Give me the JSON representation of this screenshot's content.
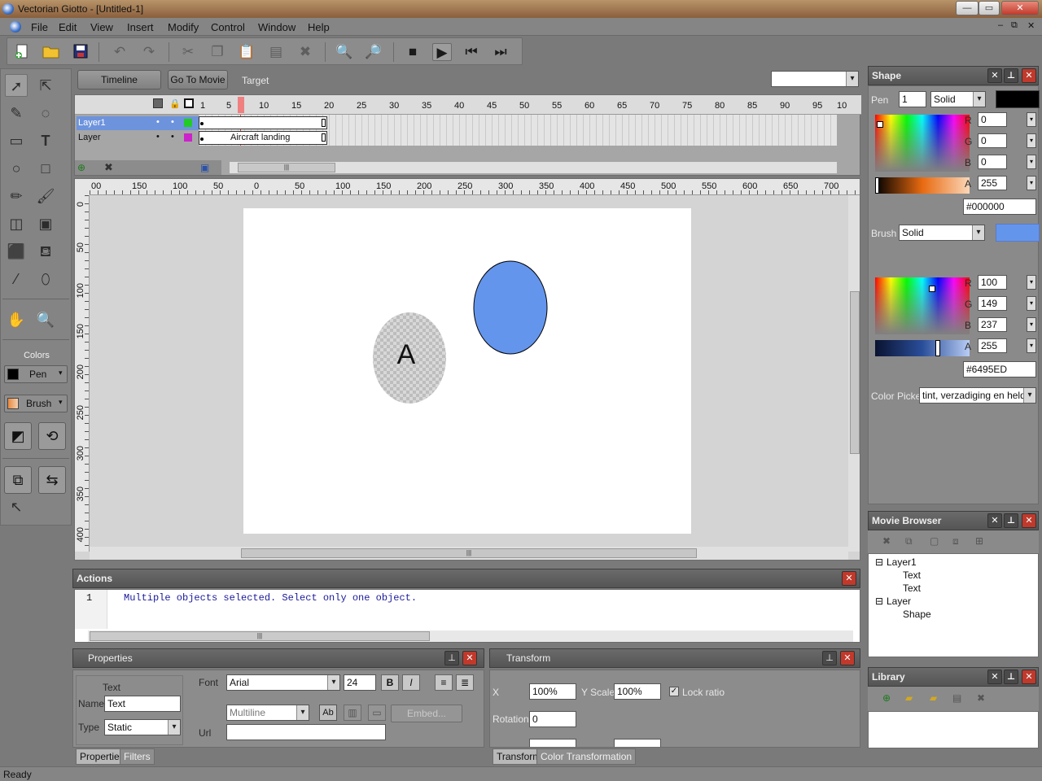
{
  "window": {
    "title": "Vectorian Giotto - [Untitled-1]",
    "min": "—",
    "max": "▭",
    "close": "✕"
  },
  "menu": {
    "items": [
      "File",
      "Edit",
      "View",
      "Insert",
      "Modify",
      "Control",
      "Window",
      "Help"
    ],
    "mdi": [
      "–",
      "⧉",
      "✕"
    ]
  },
  "toolbar": {
    "icons": [
      "new-icon",
      "open-icon",
      "save-icon",
      "undo-icon",
      "redo-icon",
      "cut-icon",
      "copy-icon",
      "paste-icon",
      "paste-special-icon",
      "delete-icon",
      "zoom-in-icon",
      "zoom-out-icon",
      "stop-icon",
      "play-icon",
      "first-frame-icon",
      "last-frame-icon"
    ]
  },
  "header": {
    "timeline_btn": "Timeline",
    "goto_btn": "Go To Movie",
    "target_label": "Target",
    "target_value": ""
  },
  "timeline": {
    "ruler": [
      "1",
      "5",
      "10",
      "15",
      "20",
      "25",
      "30",
      "35",
      "40",
      "45",
      "50",
      "55",
      "60",
      "65",
      "70",
      "75",
      "80",
      "85",
      "90",
      "95",
      "10"
    ],
    "layers": [
      {
        "name": "Layer1",
        "color": "#22cc22",
        "selected": true,
        "frame_label": ""
      },
      {
        "name": "Layer",
        "color": "#cc22cc",
        "selected": false,
        "frame_label": "Aircraft landing"
      }
    ],
    "scroll_mark": "|||"
  },
  "stage": {
    "hruler": [
      "00",
      "150",
      "100",
      "50",
      "0",
      "50",
      "100",
      "150",
      "200",
      "250",
      "300",
      "350",
      "400",
      "450",
      "500",
      "550",
      "600",
      "650",
      "700",
      "7"
    ],
    "vruler": [
      "0",
      "50",
      "100",
      "150",
      "200",
      "250",
      "300",
      "350",
      "400"
    ],
    "text_in_shape": "A",
    "ellipse_fill": "#6495ED",
    "scroll_mark": "|||"
  },
  "colors_panel": {
    "title": "Colors",
    "pen_label": "Pen",
    "brush_label": "Brush"
  },
  "shape_panel": {
    "title": "Shape",
    "pen_label": "Pen",
    "pen_width": "1",
    "pen_style": "Solid",
    "pen_color": "#000000",
    "pen_rgba": {
      "R": "0",
      "G": "0",
      "B": "0",
      "A": "255"
    },
    "pen_hex": "#000000",
    "brush_label": "Brush",
    "brush_style": "Solid",
    "brush_color": "#6495ED",
    "brush_rgba": {
      "R": "100",
      "G": "149",
      "B": "237",
      "A": "255"
    },
    "brush_hex": "#6495ED",
    "picker_label": "Color Picker",
    "picker_value": "tint, verzadiging en helde"
  },
  "movie_browser": {
    "title": "Movie Browser",
    "tree": [
      {
        "label": "Layer1",
        "toggle": "⊟",
        "children": [
          "Text",
          "Text"
        ]
      },
      {
        "label": "Layer",
        "toggle": "⊟",
        "children": [
          "Shape"
        ]
      }
    ]
  },
  "library": {
    "title": "Library"
  },
  "actions": {
    "title": "Actions",
    "line_no": "1",
    "message": "Multiple objects selected. Select only one object.",
    "scroll_mark": "|||"
  },
  "properties": {
    "title": "Properties",
    "section": "Text",
    "name_label": "Name",
    "name_value": "Text",
    "type_label": "Type",
    "type_value": "Static",
    "font_label": "Font",
    "font_value": "Arial",
    "font_size": "24",
    "bold": "B",
    "italic": "I",
    "multiline": "Multiline",
    "embed": "Embed...",
    "url_label": "Url",
    "url_value": "",
    "tabs": [
      "Properties",
      "Filters"
    ]
  },
  "transform": {
    "title": "Transform",
    "x_label": "X",
    "x_value": "100%",
    "yscale_label": "Y Scale",
    "yscale_value": "100%",
    "lock_label": "Lock ratio",
    "rotation_label": "Rotation",
    "rotation_value": "0",
    "tabs": [
      "Transform",
      "Color Transformation"
    ]
  },
  "status": {
    "text": "Ready"
  }
}
